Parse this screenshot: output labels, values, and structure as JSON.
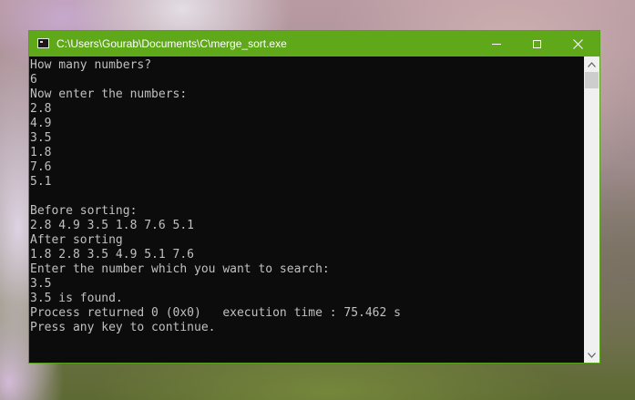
{
  "window": {
    "title": "C:\\Users\\Gourab\\Documents\\C\\merge_sort.exe",
    "icons": {
      "app": "console-app-icon",
      "minimize": "minimize-icon",
      "maximize": "maximize-icon",
      "close": "close-icon"
    },
    "colors": {
      "titlebar": "#5fa81a",
      "console_bg": "#0c0c0c",
      "console_text": "#c0c0c0"
    }
  },
  "console": {
    "lines": [
      "How many numbers?",
      "6",
      "Now enter the numbers:",
      "2.8",
      "4.9",
      "3.5",
      "1.8",
      "7.6",
      "5.1",
      "",
      "Before sorting:",
      "2.8 4.9 3.5 1.8 7.6 5.1",
      "After sorting",
      "1.8 2.8 3.5 4.9 5.1 7.6",
      "Enter the number which you want to search:",
      "3.5",
      "3.5 is found.",
      "Process returned 0 (0x0)   execution time : 75.462 s",
      "Press any key to continue."
    ]
  },
  "scrollbar": {
    "up_icon": "scroll-up-arrow-icon",
    "down_icon": "scroll-down-arrow-icon"
  }
}
